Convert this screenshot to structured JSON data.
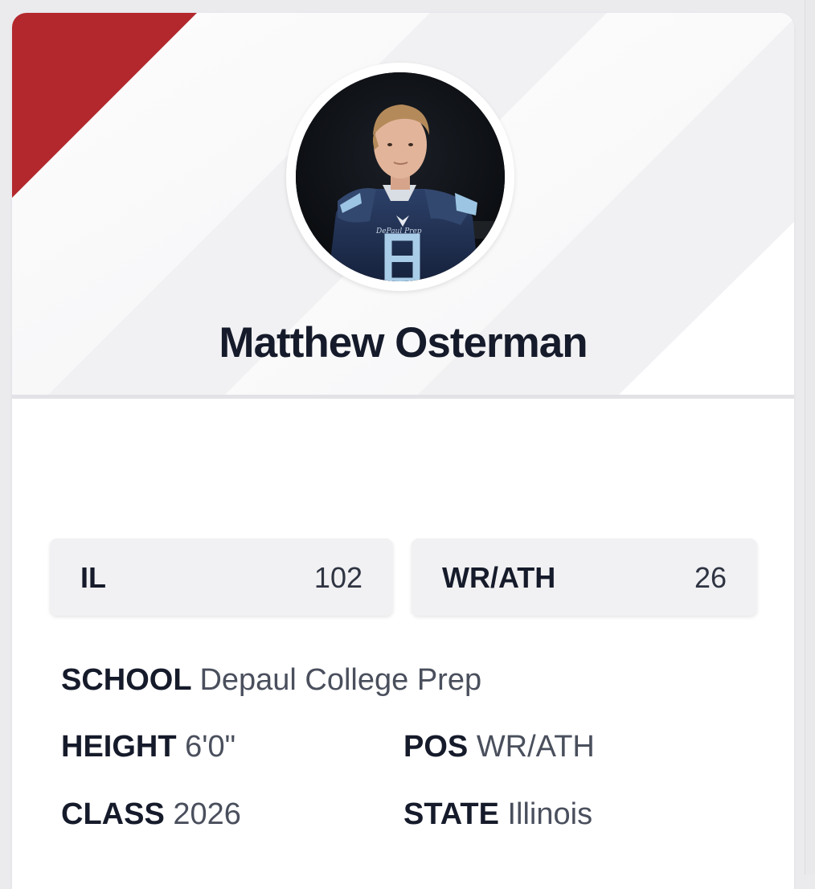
{
  "player": {
    "name": "Matthew Osterman",
    "avatar_icon": "player-photo",
    "jersey_number": "8"
  },
  "rankings": [
    {
      "label": "IL",
      "value": "102"
    },
    {
      "label": "WR/ATH",
      "value": "26"
    }
  ],
  "details": {
    "school": {
      "label": "SCHOOL",
      "value": "Depaul College Prep"
    },
    "height": {
      "label": "HEIGHT",
      "value": "6'0\""
    },
    "pos": {
      "label": "POS",
      "value": "WR/ATH"
    },
    "class": {
      "label": "CLASS",
      "value": "2026"
    },
    "state": {
      "label": "STATE",
      "value": "Illinois"
    }
  },
  "colors": {
    "accent": "#b3282d",
    "text_dark": "#161b2b",
    "text_muted": "#4a4f5d",
    "panel": "#f1f1f3"
  }
}
